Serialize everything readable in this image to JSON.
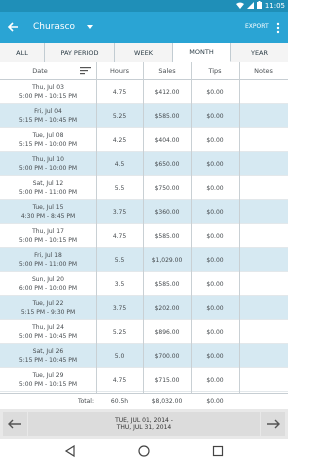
{
  "status_bar": {
    "time": "11:05"
  },
  "app_bar": {
    "title": "Churasco",
    "export_label": "EXPORT",
    "colors": {
      "status": "#1f8fb8",
      "bar": "#2aa4d4"
    }
  },
  "tabs": [
    {
      "label": "ALL",
      "active": false
    },
    {
      "label": "PAY PERIOD",
      "active": false
    },
    {
      "label": "WEEK",
      "active": false
    },
    {
      "label": "MONTH",
      "active": true
    },
    {
      "label": "YEAR",
      "active": false
    }
  ],
  "columns": {
    "date": "Date",
    "hours": "Hours",
    "sales": "Sales",
    "tips": "Tips",
    "notes": "Notes"
  },
  "rows": [
    {
      "date": "Thu, Jul 03",
      "time": "5:00 PM - 10:15 PM",
      "hours": "4.75",
      "sales": "$412.00",
      "tips": "$0.00",
      "notes": ""
    },
    {
      "date": "Fri, Jul 04",
      "time": "5:15 PM - 10:45 PM",
      "hours": "5.25",
      "sales": "$585.00",
      "tips": "$0.00",
      "notes": ""
    },
    {
      "date": "Tue, Jul 08",
      "time": "5:15 PM - 10:00 PM",
      "hours": "4.25",
      "sales": "$404.00",
      "tips": "$0.00",
      "notes": ""
    },
    {
      "date": "Thu, Jul 10",
      "time": "5:00 PM - 10:00 PM",
      "hours": "4.5",
      "sales": "$650.00",
      "tips": "$0.00",
      "notes": ""
    },
    {
      "date": "Sat, Jul 12",
      "time": "5:00 PM - 11:00 PM",
      "hours": "5.5",
      "sales": "$750.00",
      "tips": "$0.00",
      "notes": ""
    },
    {
      "date": "Tue, Jul 15",
      "time": "4:30 PM - 8:45 PM",
      "hours": "3.75",
      "sales": "$360.00",
      "tips": "$0.00",
      "notes": ""
    },
    {
      "date": "Thu, Jul 17",
      "time": "5:00 PM - 10:15 PM",
      "hours": "4.75",
      "sales": "$585.00",
      "tips": "$0.00",
      "notes": ""
    },
    {
      "date": "Fri, Jul 18",
      "time": "5:00 PM - 11:00 PM",
      "hours": "5.5",
      "sales": "$1,029.00",
      "tips": "$0.00",
      "notes": ""
    },
    {
      "date": "Sun, Jul 20",
      "time": "6:00 PM - 10:00 PM",
      "hours": "3.5",
      "sales": "$585.00",
      "tips": "$0.00",
      "notes": ""
    },
    {
      "date": "Tue, Jul 22",
      "time": "5:15 PM - 9:30 PM",
      "hours": "3.75",
      "sales": "$202.00",
      "tips": "$0.00",
      "notes": ""
    },
    {
      "date": "Thu, Jul 24",
      "time": "5:00 PM - 10:45 PM",
      "hours": "5.25",
      "sales": "$896.00",
      "tips": "$0.00",
      "notes": ""
    },
    {
      "date": "Sat, Jul 26",
      "time": "5:15 PM - 10:45 PM",
      "hours": "5.0",
      "sales": "$700.00",
      "tips": "$0.00",
      "notes": ""
    },
    {
      "date": "Tue, Jul 29",
      "time": "5:00 PM - 10:15 PM",
      "hours": "4.75",
      "sales": "$715.00",
      "tips": "$0.00",
      "notes": ""
    }
  ],
  "total": {
    "label": "Total:",
    "hours": "60.5h",
    "sales": "$8,032.00",
    "tips": "$0.00"
  },
  "footer": {
    "range_line1": "TUE, JUL 01, 2014 -",
    "range_line2": "THU, JUL 31, 2014"
  }
}
